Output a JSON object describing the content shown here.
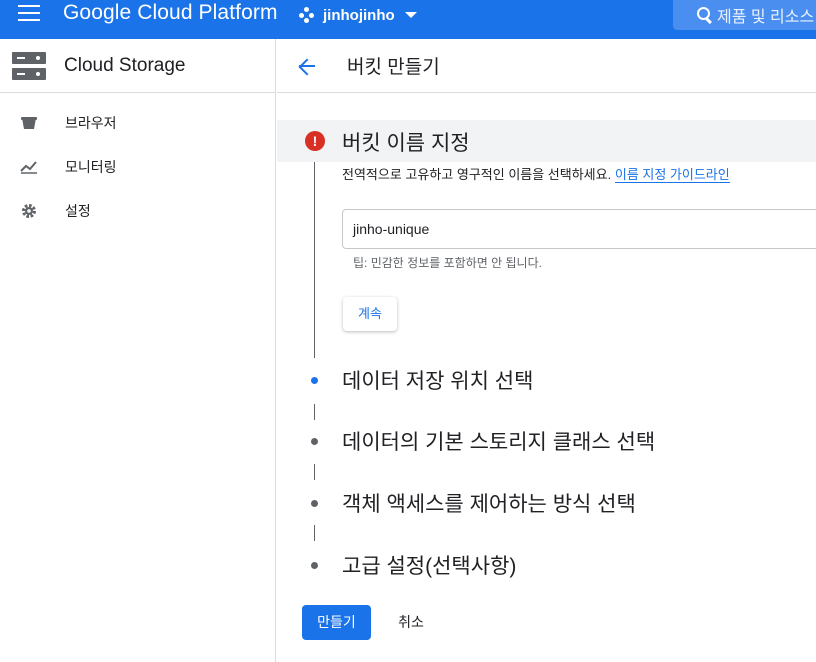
{
  "topbar": {
    "brand": "Google Cloud Platform",
    "project": "jinhojinho",
    "search_placeholder": "제품 및 리소스 검색"
  },
  "sidebar": {
    "title": "Cloud Storage",
    "items": [
      {
        "label": "브라우저",
        "icon": "bucket-icon"
      },
      {
        "label": "모니터링",
        "icon": "monitoring-icon"
      },
      {
        "label": "설정",
        "icon": "gear-icon"
      }
    ]
  },
  "main": {
    "title": "버킷 만들기",
    "active_step": {
      "title": "버킷 이름 지정",
      "description": "전역적으로 고유하고 영구적인 이름을 선택하세요.",
      "guide_link": "이름 지정 가이드라인",
      "input_value": "jinho-unique",
      "tip": "팁: 민감한 정보를 포함하면 안 됩니다.",
      "continue_label": "계속"
    },
    "steps": [
      {
        "label": "데이터 저장 위치 선택"
      },
      {
        "label": "데이터의 기본 스토리지 클래스 선택"
      },
      {
        "label": "객체 액세스를 제어하는 방식 선택"
      },
      {
        "label": "고급 설정(선택사항)"
      }
    ],
    "create_label": "만들기",
    "cancel_label": "취소"
  },
  "colors": {
    "accent": "#1a73e8",
    "error": "#d93025"
  }
}
